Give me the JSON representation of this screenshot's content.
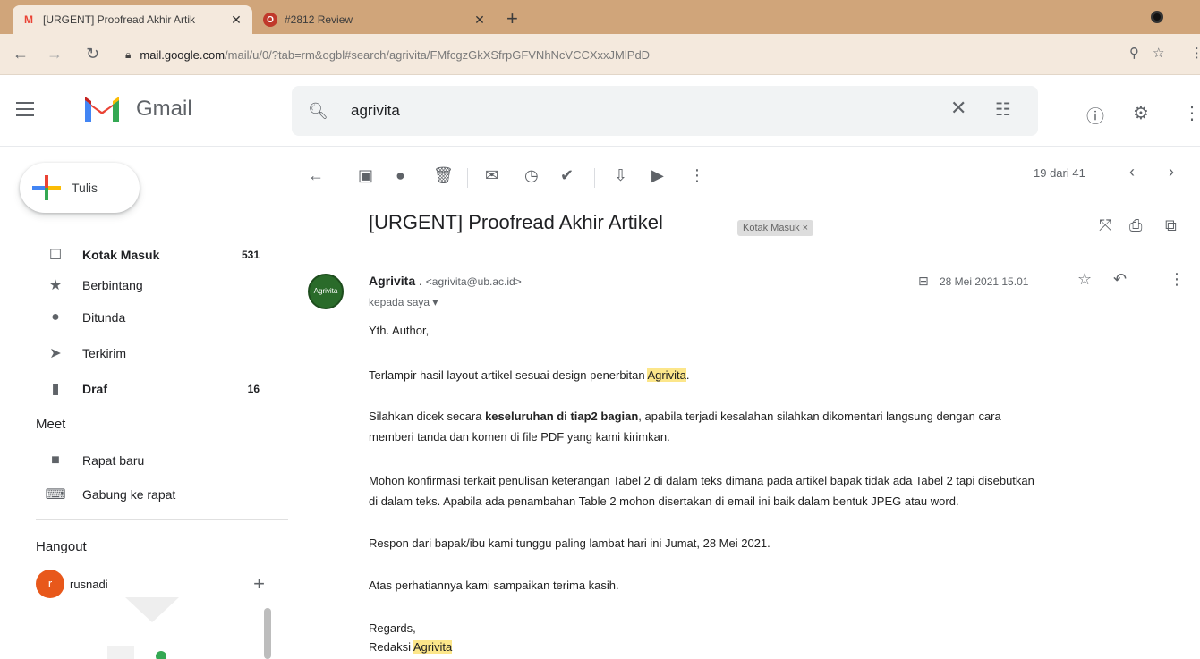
{
  "browser": {
    "tabs": [
      {
        "favicon": "M",
        "title": "[URGENT] Proofread Akhir Artik",
        "active": true
      },
      {
        "favicon": "O",
        "title": "#2812 Review",
        "active": false
      }
    ],
    "url_host": "mail.google.com",
    "url_path": "/mail/u/0/?tab=rm&ogbl#search/agrivita/FMfcgzGkXSfrpGFVNhNcVCCXxxJMlPdD"
  },
  "header": {
    "brand": "Gmail",
    "search_value": "agrivita"
  },
  "sidebar": {
    "compose_label": "Tulis",
    "items": [
      {
        "icon": "inbox-icon",
        "label": "Kotak Masuk",
        "count": "531",
        "bold": true
      },
      {
        "icon": "star-icon",
        "label": "Berbintang",
        "count": "",
        "bold": false
      },
      {
        "icon": "clock-icon",
        "label": "Ditunda",
        "count": "",
        "bold": false
      },
      {
        "icon": "send-icon",
        "label": "Terkirim",
        "count": "",
        "bold": false
      },
      {
        "icon": "draft-icon",
        "label": "Draf",
        "count": "16",
        "bold": true
      }
    ],
    "meet": {
      "title": "Meet",
      "items": [
        {
          "icon": "video-icon",
          "label": "Rapat baru"
        },
        {
          "icon": "keyboard-icon",
          "label": "Gabung ke rapat"
        }
      ]
    },
    "hangout": {
      "title": "Hangout",
      "user_initial": "r",
      "user_name": "rusnadi"
    }
  },
  "toolbar": {
    "pager": "19 dari 41"
  },
  "message": {
    "subject": "[URGENT] Proofread Akhir Artikel",
    "label": "Kotak Masuk",
    "sender_name": "Agrivita",
    "sender_email": "<agrivita@ub.ac.id>",
    "to": "kepada saya",
    "date": "28 Mei 2021 15.01",
    "avatar_text": "Agrivita",
    "body": {
      "greeting": "Yth. Author,",
      "p1_pre": "Terlampir hasil layout artikel sesuai design penerbitan ",
      "p1_hl": "Agrivita",
      "p1_post": ".",
      "p2_pre": "Silahkan dicek secara ",
      "p2_bold": "keseluruhan di tiap2 bagian",
      "p2_post": ", apabila terjadi kesalahan silahkan dikomentari langsung dengan cara",
      "p2_line2": "memberi tanda dan komen di file PDF yang kami kirimkan.",
      "p3_line1": "Mohon konfirmasi terkait penulisan keterangan Tabel 2 di dalam teks dimana pada artikel bapak tidak ada Tabel 2 tapi disebutkan",
      "p3_line2": "di dalam teks. Apabila ada penambahan Table 2 mohon disertakan di email ini baik dalam bentuk JPEG atau word.",
      "p4": "Respon dari bapak/ibu kami tunggu paling lambat hari ini Jumat, 28 Mei 2021.",
      "p5": "Atas perhatiannya kami sampaikan terima kasih.",
      "signoff": "Regards,",
      "sig_pre": "Redaksi ",
      "sig_hl": "Agrivita"
    }
  },
  "colors": {
    "tabstrip": "#d0a57a",
    "addrbar": "#f4e9dd",
    "highlight": "#fce68a",
    "gmail_red": "#ea4335"
  }
}
